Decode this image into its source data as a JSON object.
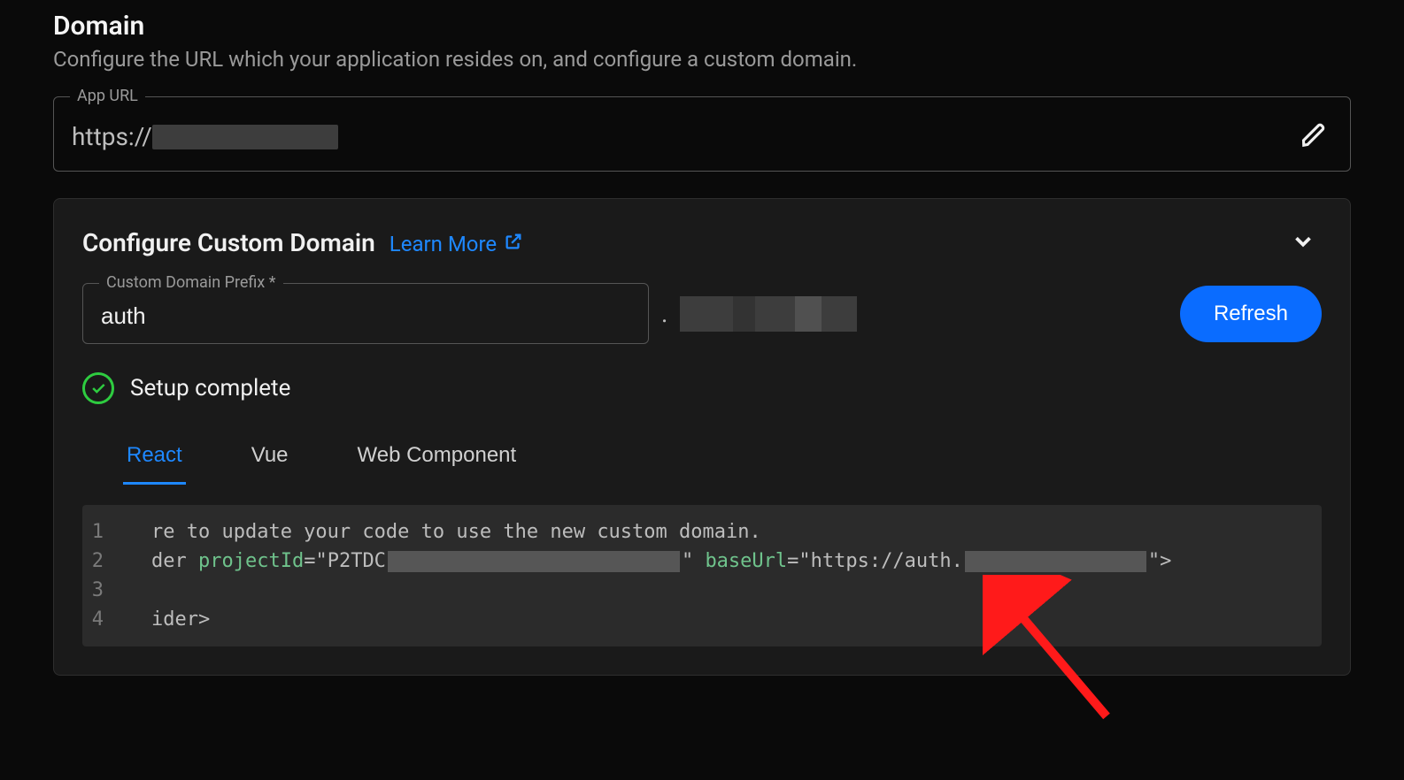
{
  "section": {
    "title": "Domain",
    "subtitle": "Configure the URL which your application resides on, and configure a custom domain."
  },
  "appUrl": {
    "label": "App URL",
    "valuePrefix": "https://"
  },
  "panel": {
    "title": "Configure Custom Domain",
    "learnMore": "Learn More",
    "prefix": {
      "label": "Custom Domain Prefix *",
      "value": "auth",
      "dot": "."
    },
    "refreshLabel": "Refresh",
    "status": "Setup complete",
    "tabs": [
      {
        "id": "react",
        "label": "React",
        "active": true
      },
      {
        "id": "vue",
        "label": "Vue",
        "active": false
      },
      {
        "id": "wc",
        "label": "Web Component",
        "active": false
      }
    ],
    "code": {
      "line1_a": "re to update your code to use the new custom domain.",
      "line2_a": "der ",
      "line2_attr1": "projectId",
      "line2_eq": "=",
      "line2_q": "\"",
      "line2_val1_prefix": "P2TDC",
      "line2_attr2": "baseUrl",
      "line2_val2_prefix": "https://auth.",
      "line2_close": "\">",
      "line4_a": "ider",
      "line4_b": ">"
    },
    "lineNumbers": [
      "1",
      "2",
      "3",
      "4"
    ]
  }
}
